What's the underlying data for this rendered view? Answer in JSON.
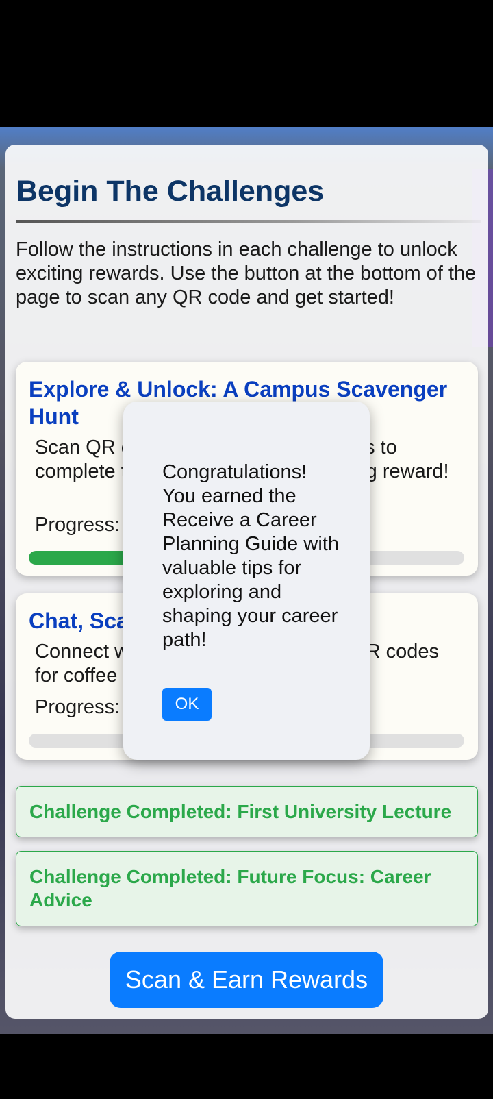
{
  "header": {
    "title": "Begin The Challenges",
    "intro": "Follow the instructions in each challenge to unlock exciting rewards. Use the button at the bottom of the page to scan any QR code and get started!"
  },
  "challenges": [
    {
      "title": "Explore & Unlock: A Campus Scavenger Hunt",
      "description": "Scan QR codes and follow instructions to complete the hunt and earn an exciting reward!",
      "progress_label": "Progress:",
      "progress_fraction": 0.25
    },
    {
      "title": "Chat, Scan",
      "description": "Connect with people and scan their QR codes for coffee on us!",
      "progress_label": "Progress:",
      "progress_fraction": 0.0
    }
  ],
  "completed": [
    {
      "text": "Challenge Completed: First University Lecture"
    },
    {
      "text": "Challenge Completed: Future Focus: Career Advice"
    }
  ],
  "scan_button": {
    "label": "Scan & Earn Rewards"
  },
  "modal": {
    "message": "Congratulations! You earned the Receive a Career Planning Guide with valuable tips for exploring and shaping your career path!",
    "ok_label": "OK"
  },
  "colors": {
    "title": "#0d3566",
    "challenge_title": "#0a3fbf",
    "progress_fill": "#2ba84a",
    "completed_text": "#2ba84a",
    "primary_button": "#0a7cff"
  }
}
